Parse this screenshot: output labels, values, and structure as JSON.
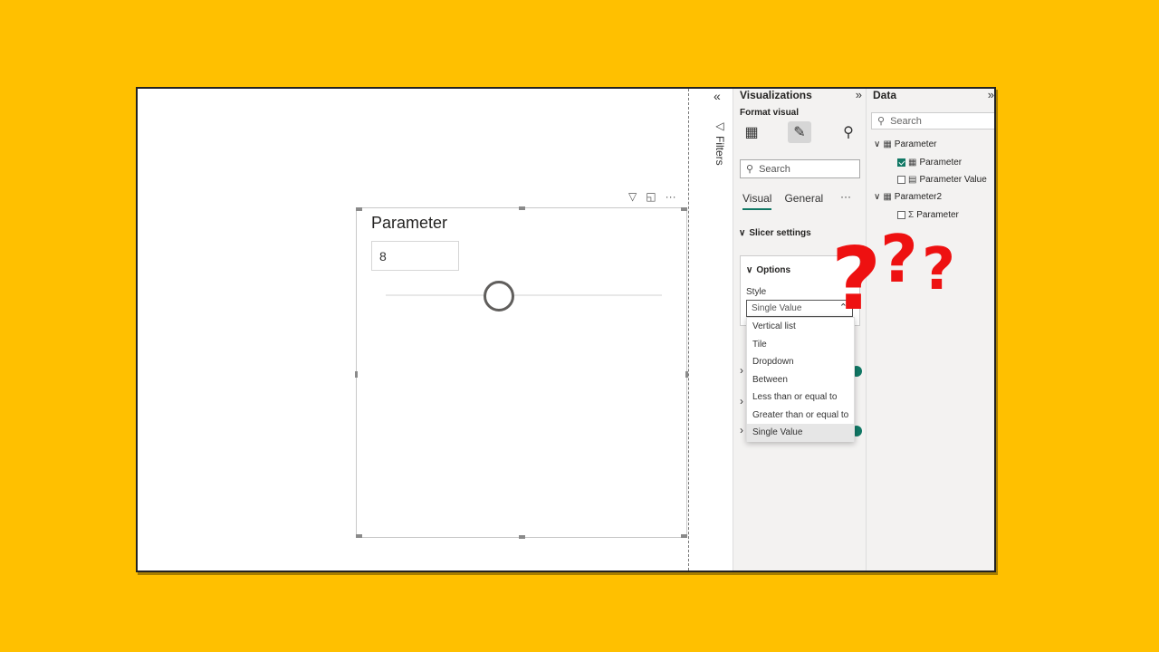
{
  "colors": {
    "background": "#FFC000",
    "accent": "#117865",
    "question_marks": "#EE1111"
  },
  "slicer": {
    "title": "Parameter",
    "value": "8",
    "toolbar_icons": [
      "filter-icon",
      "focus-mode-icon",
      "more-options-icon"
    ]
  },
  "filters_pane": {
    "label": "Filters",
    "collapse_icon": "«"
  },
  "visualizations_pane": {
    "title": "Visualizations",
    "expand_icon": "»",
    "format_label": "Format visual",
    "format_icons": [
      "build-visual-icon",
      "format-visual-icon",
      "analytics-icon"
    ],
    "search_placeholder": "Search",
    "tabs": [
      "Visual",
      "General"
    ],
    "active_tab": "Visual",
    "more_icon": "···",
    "section": "Slicer settings",
    "options": {
      "label": "Options",
      "style_label": "Style",
      "style_value": "Single Value"
    },
    "dropdown_options": [
      "Vertical list",
      "Tile",
      "Dropdown",
      "Between",
      "Less than or equal to",
      "Greater than or equal to",
      "Single Value"
    ],
    "selected_option": "Single Value"
  },
  "data_pane": {
    "title": "Data",
    "expand_icon": "»",
    "search_placeholder": "Search",
    "tables": [
      {
        "name": "Parameter",
        "fields": [
          {
            "name": "Parameter",
            "checked": true
          },
          {
            "name": "Parameter Value",
            "checked": false
          }
        ]
      },
      {
        "name": "Parameter2",
        "fields": [
          {
            "name": "Parameter",
            "checked": false
          }
        ]
      }
    ]
  },
  "overlay": {
    "question_marks": "???"
  }
}
